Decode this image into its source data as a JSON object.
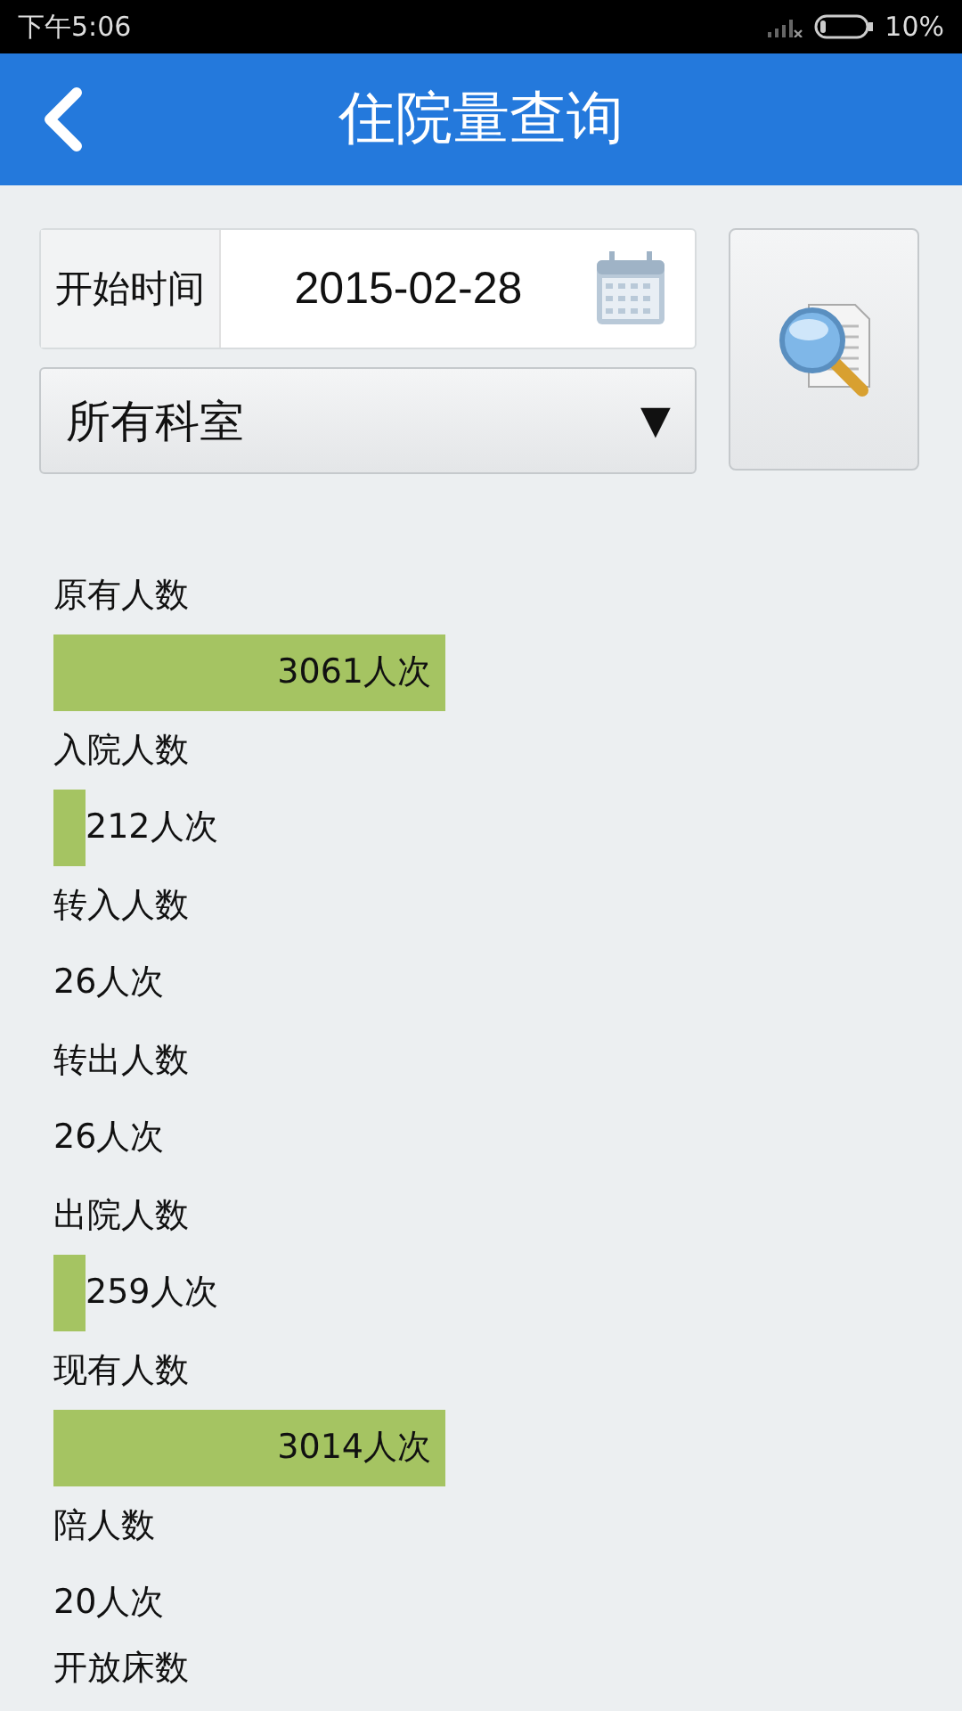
{
  "status_bar": {
    "time": "下午5:06",
    "battery": "10%"
  },
  "header": {
    "title": "住院量查询"
  },
  "form": {
    "date_label": "开始时间",
    "date_value": "2015-02-28",
    "department": "所有科室",
    "dropdown_arrow": "▼"
  },
  "stats": [
    {
      "kind": "long",
      "label": "原有人数",
      "value": "3061人次"
    },
    {
      "kind": "short",
      "label": "入院人数",
      "value": "212人次"
    },
    {
      "kind": "plain",
      "label": "转入人数",
      "value": "26人次"
    },
    {
      "kind": "plain",
      "label": "转出人数",
      "value": "26人次"
    },
    {
      "kind": "short",
      "label": "出院人数",
      "value": "259人次"
    },
    {
      "kind": "long",
      "label": "现有人数",
      "value": "3014人次"
    },
    {
      "kind": "plain",
      "label": "陪人数",
      "value": "20人次"
    }
  ],
  "cut_label": "开放床数"
}
